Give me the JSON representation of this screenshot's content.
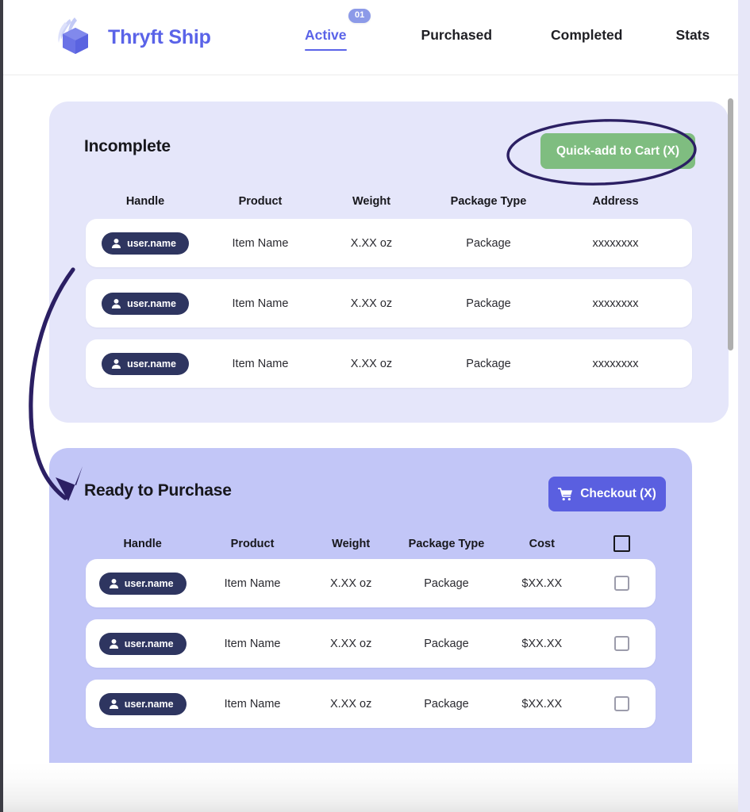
{
  "app": {
    "brand_name": "Thryft Ship",
    "logo_icon": "winged-box-logo",
    "brand_color": "#5a63e8"
  },
  "nav": {
    "items": [
      {
        "label": "Active",
        "active": true,
        "badge": "01"
      },
      {
        "label": "Purchased",
        "active": false,
        "badge": ""
      },
      {
        "label": "Completed",
        "active": false,
        "badge": ""
      },
      {
        "label": "Stats",
        "active": false,
        "badge": ""
      }
    ]
  },
  "incomplete": {
    "title": "Incomplete",
    "action_label": "Quick-add to Cart (X)",
    "action_color": "#7fbd80",
    "columns": [
      "Handle",
      "Product",
      "Weight",
      "Package Type",
      "Address"
    ],
    "rows": [
      {
        "handle": "user.name",
        "product": "Item Name",
        "weight": "X.XX oz",
        "package": "Package",
        "address": "xxxxxxxx"
      },
      {
        "handle": "user.name",
        "product": "Item Name",
        "weight": "X.XX oz",
        "package": "Package",
        "address": "xxxxxxxx"
      },
      {
        "handle": "user.name",
        "product": "Item Name",
        "weight": "X.XX oz",
        "package": "Package",
        "address": "xxxxxxxx"
      }
    ]
  },
  "ready": {
    "title": "Ready to Purchase",
    "action_label": "Checkout (X)",
    "action_icon": "shopping-cart-icon",
    "action_color": "#5a5fe0",
    "columns": [
      "Handle",
      "Product",
      "Weight",
      "Package Type",
      "Cost"
    ],
    "select_all_checked": false,
    "rows": [
      {
        "handle": "user.name",
        "product": "Item Name",
        "weight": "X.XX oz",
        "package": "Package",
        "cost": "$XX.XX",
        "checked": false
      },
      {
        "handle": "user.name",
        "product": "Item Name",
        "weight": "X.XX oz",
        "package": "Package",
        "cost": "$XX.XX",
        "checked": false
      },
      {
        "handle": "user.name",
        "product": "Item Name",
        "weight": "X.XX oz",
        "package": "Package",
        "cost": "$XX.XX",
        "checked": false
      }
    ]
  },
  "annotations": {
    "color": "#2b1f63",
    "ellipse_target": "Quick-add to Cart (X)",
    "arrow_target": "Ready to Purchase"
  },
  "colors": {
    "incomplete_card": "#e5e6fa",
    "ready_card": "#c2c6f7",
    "handle_pill": "#2e3560",
    "nav_badge": "#8c9ae8"
  }
}
